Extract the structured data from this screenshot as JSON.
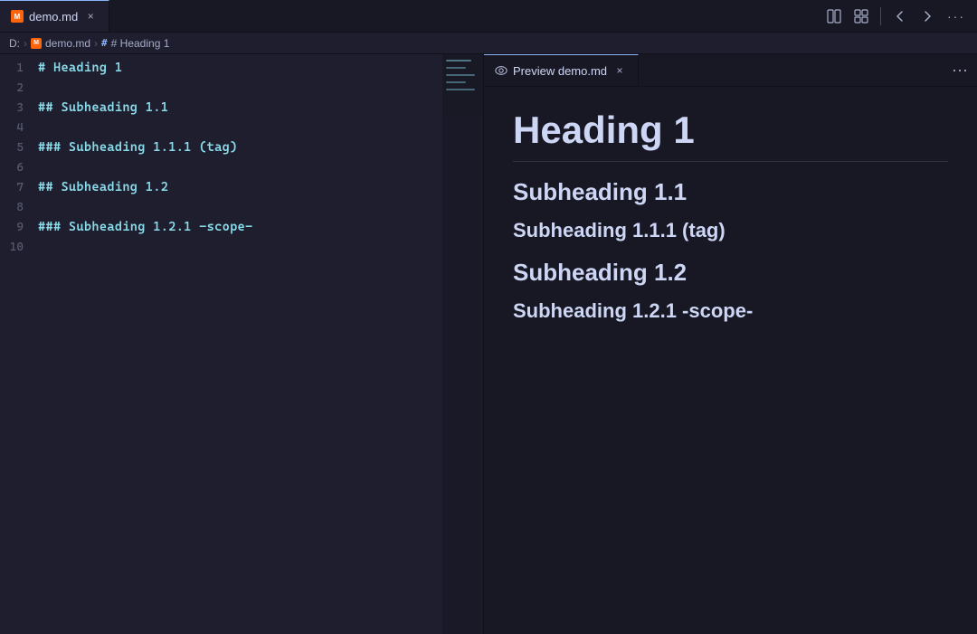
{
  "tabs": {
    "editor": {
      "label": "demo.md",
      "icon": "md-icon",
      "close_label": "×"
    },
    "preview": {
      "label": "Preview demo.md",
      "close_label": "×"
    }
  },
  "toolbar": {
    "split_editor_icon": "⊟",
    "layout_icon": "⊞",
    "back_icon": "←",
    "forward_icon": "→",
    "more_icon": "···"
  },
  "breadcrumb": {
    "drive": "D:",
    "file": "demo.md",
    "heading": "# Heading 1"
  },
  "editor": {
    "lines": [
      {
        "num": 1,
        "content": "# Heading 1",
        "level": "h1"
      },
      {
        "num": 2,
        "content": "",
        "level": ""
      },
      {
        "num": 3,
        "content": "## Subheading 1.1",
        "level": "h2"
      },
      {
        "num": 4,
        "content": "",
        "level": ""
      },
      {
        "num": 5,
        "content": "### Subheading 1.1.1 (tag)",
        "level": "h3"
      },
      {
        "num": 6,
        "content": "",
        "level": ""
      },
      {
        "num": 7,
        "content": "## Subheading 1.2",
        "level": "h2"
      },
      {
        "num": 8,
        "content": "",
        "level": ""
      },
      {
        "num": 9,
        "content": "### Subheading 1.2.1 -scope-",
        "level": "h3"
      },
      {
        "num": 10,
        "content": "",
        "level": ""
      }
    ]
  },
  "preview": {
    "heading1": "Heading 1",
    "heading2_1": "Subheading 1.1",
    "heading3_1": "Subheading 1.1.1 (tag)",
    "heading2_2": "Subheading 1.2",
    "heading3_2": "Subheading 1.2.1 -scope-"
  },
  "preview_more_icon": "···"
}
